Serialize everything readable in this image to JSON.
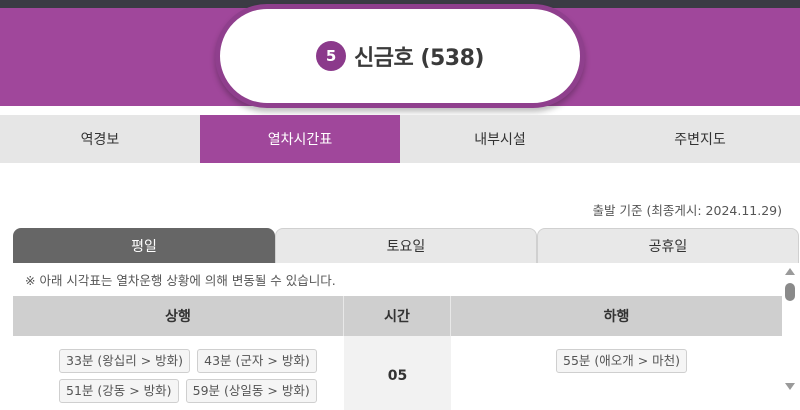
{
  "header": {
    "line_number": "5",
    "station_title": "신금호 (538)",
    "line_color": "#a0479b"
  },
  "main_tabs": [
    {
      "label": "역경보",
      "active": false
    },
    {
      "label": "열차시간표",
      "active": true
    },
    {
      "label": "내부시설",
      "active": false
    },
    {
      "label": "주변지도",
      "active": false
    }
  ],
  "basis_text": "출발 기준 (최종게시: 2024.11.29)",
  "day_tabs": [
    {
      "label": "평일",
      "active": true
    },
    {
      "label": "토요일",
      "active": false
    },
    {
      "label": "공휴일",
      "active": false
    }
  ],
  "notice": "※ 아래 시각표는 열차운행 상황에 의해 변동될 수 있습니다.",
  "timetable": {
    "headers": {
      "up": "상행",
      "hour": "시간",
      "down": "하행"
    },
    "rows": [
      {
        "hour": "05",
        "up": [
          "33분 (왕십리 > 방화)",
          "43분 (군자 > 방화)",
          "51분 (강동 > 방화)",
          "59분 (상일동 > 방화)"
        ],
        "down": [
          "55분 (애오개 > 마천)"
        ]
      }
    ]
  }
}
